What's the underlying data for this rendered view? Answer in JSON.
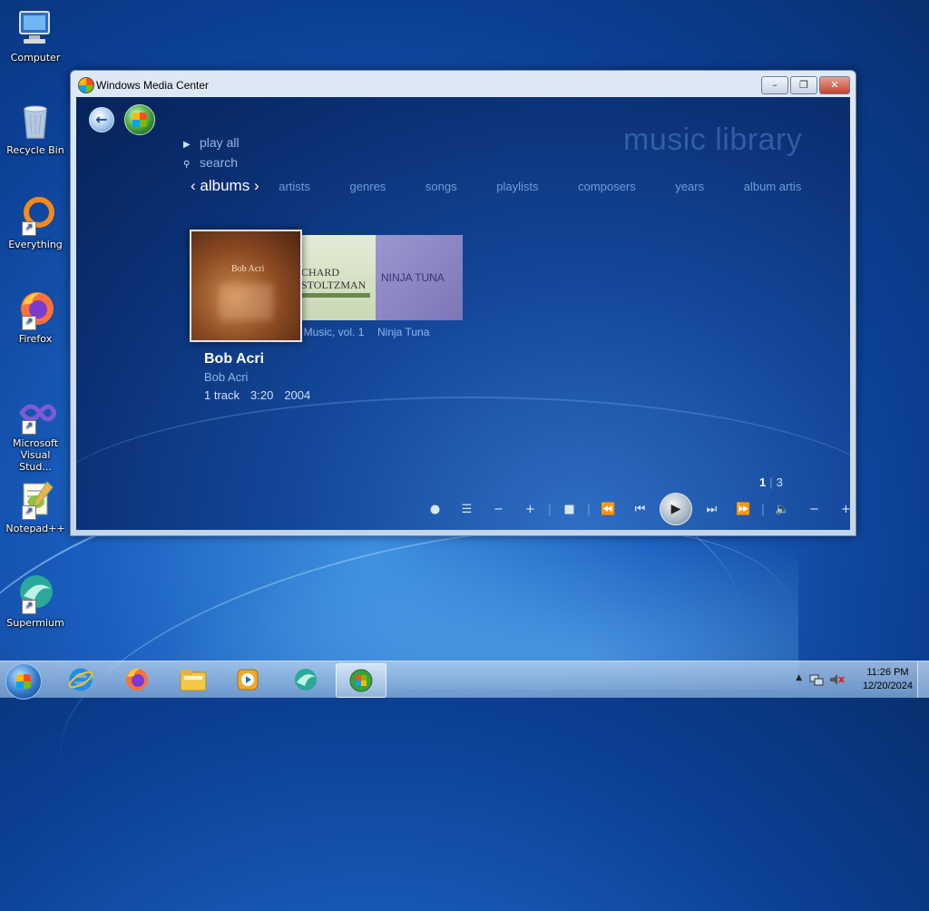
{
  "desktop": {
    "icons": [
      {
        "label": "Computer"
      },
      {
        "label": "Recycle Bin"
      },
      {
        "label": "Everything"
      },
      {
        "label": "Firefox"
      },
      {
        "label": "Microsoft Visual Stud..."
      },
      {
        "label": "Notepad++"
      },
      {
        "label": "Supermium"
      }
    ]
  },
  "window": {
    "title": "Windows Media Center",
    "buttons": {
      "minimize": "–",
      "restore": "❐",
      "close": "✕"
    }
  },
  "wmc": {
    "page_title": "music library",
    "menu": {
      "play_all": "play all",
      "search": "search"
    },
    "pivot": {
      "active": "albums",
      "prev_glyph": "‹",
      "next_glyph": "›",
      "items": [
        "artists",
        "genres",
        "songs",
        "playlists",
        "composers",
        "years",
        "album artis"
      ]
    },
    "albums": [
      {
        "cover_text": "Bob Acri",
        "caption": ""
      },
      {
        "cover_text_1": "CHARD",
        "cover_text_2": "STOLTZMAN",
        "caption": "he Music, vol. 1"
      },
      {
        "cover_text": "NINJA TUNA",
        "caption": "Ninja Tuna"
      }
    ],
    "selected": {
      "title": "Bob Acri",
      "artist": "Bob Acri",
      "tracks": "1 track",
      "duration": "3:20",
      "year": "2004"
    },
    "pager": {
      "current": "1",
      "total": "3"
    },
    "transport": {
      "record": "●",
      "guide": "☰",
      "minus": "−",
      "plus": "+",
      "stop": "■",
      "rewind": "⏪",
      "prev": "⏮",
      "play": "▶",
      "next": "⏭",
      "forward": "⏩",
      "volume": "🔈",
      "vol_down": "−",
      "vol_up": "+"
    }
  },
  "taskbar": {
    "clock_time": "11:26 PM",
    "clock_date": "12/20/2024",
    "tray_arrow": "▲"
  },
  "colors": {
    "accent": "#1a5fc0",
    "wmc_text": "#8fb7e6"
  }
}
